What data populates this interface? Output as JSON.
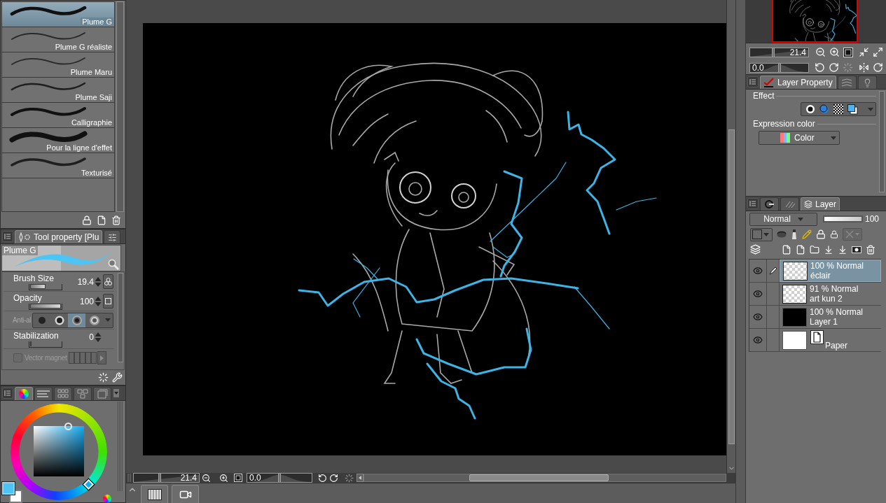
{
  "brush_list": {
    "items": [
      {
        "name": "Plume G",
        "selected": true
      },
      {
        "name": "Plume G réaliste",
        "selected": false
      },
      {
        "name": "Plume Maru",
        "selected": false
      },
      {
        "name": "Plume Saji",
        "selected": false
      },
      {
        "name": "Calligraphie",
        "selected": false
      },
      {
        "name": "Pour la ligne d'effet",
        "selected": false
      },
      {
        "name": "Texturisé",
        "selected": false
      }
    ]
  },
  "tool_property": {
    "tabs": [
      {
        "label": "Tool property [Plu",
        "selected": true
      },
      {
        "selected": false
      }
    ],
    "preview_label": "Plume G",
    "rows": [
      {
        "kind": "slider",
        "label": "Brush Size",
        "value": "19.4",
        "level": 0.5
      },
      {
        "kind": "slider",
        "label": "Opacity",
        "value": "100",
        "level": 1
      },
      {
        "kind": "antialias",
        "label": "Anti-al",
        "disabled": true,
        "options": [
          {
            "selected": false
          },
          {
            "selected": false
          },
          {
            "selected": true
          },
          {
            "selected": false
          }
        ]
      },
      {
        "kind": "slider",
        "label": "Stabilization",
        "value": "0",
        "level": 0
      },
      {
        "kind": "checkbox",
        "label": "Vector magnet",
        "checked": false,
        "disabled": true
      }
    ]
  },
  "color_panel": {
    "tabs": [
      {
        "selected": true
      },
      {
        "selected": false
      },
      {
        "selected": false
      },
      {
        "selected": false
      },
      {
        "selected": false
      }
    ],
    "swatches": [
      {
        "color": "#4ec3f5",
        "selected": true
      },
      {
        "color": "#ffffff",
        "selected": false
      }
    ]
  },
  "canvas_bar": {
    "zoom": {
      "value": "21.4",
      "level": 0.4
    },
    "rotation": {
      "value": "0.0",
      "level": 0.5
    }
  },
  "navigator": {
    "zoom": {
      "value": "21.4",
      "level": 0.4
    },
    "rotation": {
      "value": "0.0",
      "level": 0.5
    }
  },
  "layer_property": {
    "tabs": [
      {
        "label": "Layer Property",
        "selected": true
      },
      {
        "selected": false
      },
      {
        "selected": false
      }
    ],
    "effect_label": "Effect",
    "expression_label": "Expression color",
    "expression_value": "Color"
  },
  "layer_panel": {
    "tabs": [
      {
        "selected": false
      },
      {
        "selected": false
      },
      {
        "label": "Layer",
        "selected": true
      }
    ],
    "blend_mode": "Normal",
    "opacity": {
      "value": "100",
      "level": 1
    },
    "layers": [
      {
        "kind": "raster",
        "info": "100 % Normal",
        "name": "éclair",
        "selected": true,
        "visible": true,
        "editing": true
      },
      {
        "kind": "raster",
        "info": "91 % Normal",
        "name": "art kun 2",
        "selected": false,
        "visible": true,
        "editing": false
      },
      {
        "kind": "fill",
        "info": "100 % Normal",
        "name": "Layer 1",
        "selected": false,
        "visible": true,
        "editing": false
      },
      {
        "kind": "paper",
        "name": "Paper",
        "selected": false,
        "visible": true,
        "editing": false
      }
    ]
  }
}
